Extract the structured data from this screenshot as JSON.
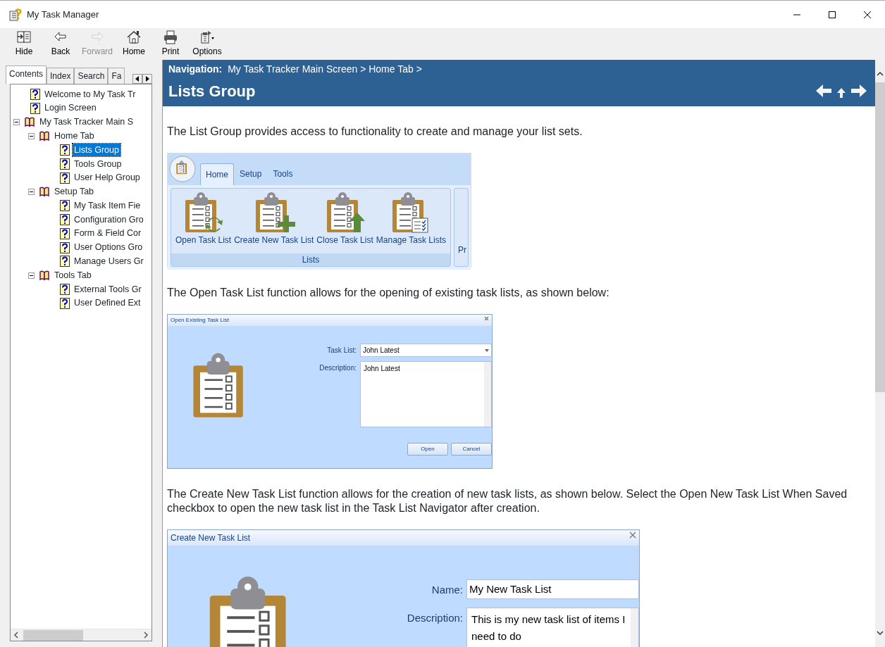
{
  "window": {
    "title": "My Task Manager"
  },
  "toolbar": [
    {
      "label": "Hide",
      "disabled": false
    },
    {
      "label": "Back",
      "disabled": false
    },
    {
      "label": "Forward",
      "disabled": true
    },
    {
      "label": "Home",
      "disabled": false
    },
    {
      "label": "Print",
      "disabled": false
    },
    {
      "label": "Options",
      "disabled": false
    }
  ],
  "left_pane": {
    "tabs": [
      {
        "label": "Contents",
        "selected": true
      },
      {
        "label": "Index",
        "selected": false
      },
      {
        "label": "Search",
        "selected": false
      },
      {
        "label": "Fa",
        "selected": false
      }
    ],
    "tree": [
      {
        "label": "Welcome to My Task Tr",
        "kind": "page",
        "selected": false
      },
      {
        "label": "Login Screen",
        "kind": "page",
        "selected": false
      },
      {
        "label": "My Task Tracker Main S",
        "kind": "book",
        "expanded": true,
        "selected": false,
        "children": [
          {
            "label": "Home Tab",
            "kind": "book",
            "expanded": true,
            "selected": false,
            "children": [
              {
                "label": "Lists Group",
                "kind": "page",
                "selected": true
              },
              {
                "label": "Tools Group",
                "kind": "page",
                "selected": false
              },
              {
                "label": "User Help Group",
                "kind": "page",
                "selected": false
              }
            ]
          },
          {
            "label": "Setup Tab",
            "kind": "book",
            "expanded": true,
            "selected": false,
            "children": [
              {
                "label": "My Task Item Fie",
                "kind": "page",
                "selected": false
              },
              {
                "label": "Configuration Gro",
                "kind": "page",
                "selected": false
              },
              {
                "label": "Form & Field Cor",
                "kind": "page",
                "selected": false
              },
              {
                "label": "User Options Gro",
                "kind": "page",
                "selected": false
              },
              {
                "label": "Manage Users Gr",
                "kind": "page",
                "selected": false
              }
            ]
          },
          {
            "label": "Tools Tab",
            "kind": "book",
            "expanded": true,
            "selected": false,
            "children": [
              {
                "label": "External Tools Gr",
                "kind": "page",
                "selected": false
              },
              {
                "label": "User Defined Ext",
                "kind": "page",
                "selected": false
              }
            ]
          }
        ]
      }
    ]
  },
  "content": {
    "navigation_label": "Navigation:",
    "breadcrumb": "My Task Tracker Main Screen > Home Tab >",
    "title": "Lists Group",
    "blocks": [
      {
        "kind": "paragraph",
        "text": "The List Group provides access to functionality to create and manage your list sets."
      },
      {
        "kind": "ribbon",
        "tabs": [
          {
            "label": "Home",
            "selected": true
          },
          {
            "label": "Setup",
            "selected": false
          },
          {
            "label": "Tools",
            "selected": false
          }
        ],
        "buttons": [
          "Open Task List",
          "Create New Task List",
          "Close Task List",
          "Manage Task Lists"
        ],
        "group_label": "Lists",
        "cut_label": "Pr"
      },
      {
        "kind": "paragraph",
        "text": "The Open Task List function allows for the opening of existing task lists, as shown below:"
      },
      {
        "kind": "open_dialog",
        "title": "Open Existing Task List",
        "fields": [
          {
            "label": "Task List:",
            "value": "John Latest",
            "kind": "combo"
          },
          {
            "label": "Description:",
            "value": "John Latest",
            "kind": "memo"
          }
        ],
        "buttons": [
          "Open",
          "Cancel"
        ]
      },
      {
        "kind": "paragraph",
        "text": "The Create New Task List function allows for the creation of new task lists, as shown below. Select the Open New Task List When Saved checkbox to open the new task list in the Task List Navigator after creation."
      },
      {
        "kind": "create_dialog",
        "title": "Create New Task List",
        "fields": [
          {
            "label": "Name:",
            "value": "My New Task List",
            "kind": "text"
          },
          {
            "label": "Description:",
            "value": "This is my new task list of items I need to do",
            "kind": "memo"
          }
        ]
      }
    ]
  }
}
